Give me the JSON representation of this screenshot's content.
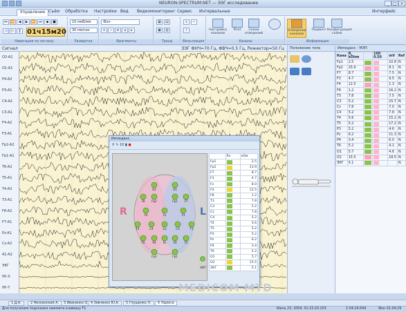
{
  "window": {
    "title": "NEURON-SPECTRUM.NET — ЭЭГ исследование"
  },
  "tabs": [
    "Управление",
    "Съём",
    "Обработка",
    "Настройки",
    "Вид",
    "Видеомониторинг",
    "Сервис",
    "Интервальные"
  ],
  "tab_right": "Интерфейс",
  "ribbon": {
    "time": "01ч15м20",
    "speed": "10 мкВ/мм",
    "sens": "30 мм/сек",
    "montage": "Фон",
    "groups": [
      "Навигация по сигналу",
      "Развертка",
      "Фрагменты",
      "Тренд",
      "Фильтрация",
      "Каналы",
      "Информация"
    ],
    "buttons": {
      "setup_channels": "Настройка каналов",
      "print": "Print",
      "scheme": "Схема отведений",
      "impedance": "Отведение каналов",
      "patient": "Пациент",
      "config": "Конфигурация съёма"
    }
  },
  "subbar": {
    "left": "Сигнал",
    "right": "ЭЭГ ФНЧ=70 Гц, ФВЧ=0.5 Гц, Режектор=50 Гц"
  },
  "channels": [
    "O2-A2",
    "O1-A1",
    "P4-A2",
    "P3-A1",
    "C4-A2",
    "C3-A1",
    "F4-A2",
    "F3-A1",
    "Fp2-A2",
    "Fp1-A1",
    "T6-A2",
    "T5-A1",
    "T4-A2",
    "T3-A1",
    "F8-A2",
    "F7-A1",
    "Pz-A1",
    "Cz-A2",
    "A1-A2",
    "ЭКГ",
    "УК-X",
    "УК-Y"
  ],
  "middle_panel": {
    "header": "Положение тела"
  },
  "impedance_panel": {
    "header": "Импеданс - МЭП",
    "columns": [
      "Кана",
      "R, kOhm",
      "",
      "100 0.50",
      "mV",
      "Ref"
    ],
    "rows": [
      [
        "Fp1",
        "2.5",
        "10.8",
        "N"
      ],
      [
        "Fp2",
        "25.9",
        "8.1",
        "N"
      ],
      [
        "F7",
        "8.7",
        "7.5",
        "N"
      ],
      [
        "F3",
        "4.7",
        "9.5",
        "N"
      ],
      [
        "F4",
        "12.5",
        "1.3",
        "N"
      ],
      [
        "F8",
        "1.2",
        "16.2",
        "N"
      ],
      [
        "T3",
        "7.8",
        "7.5",
        "N"
      ],
      [
        "C3",
        "5.2",
        "15.7",
        "N"
      ],
      [
        "Cz",
        "7.8",
        "7.0",
        "N"
      ],
      [
        "C4",
        "5.2",
        "7.8",
        "N"
      ],
      [
        "T4",
        "5.6",
        "15.2",
        "N"
      ],
      [
        "T5",
        "5.2",
        "17.2",
        "N"
      ],
      [
        "P3",
        "5.2",
        "4.6",
        "N"
      ],
      [
        "Pz",
        "6.2",
        "11.3",
        "N"
      ],
      [
        "P4",
        "3.4",
        "6.0",
        "N"
      ],
      [
        "T6",
        "5.2",
        "4.1",
        "N"
      ],
      [
        "O1",
        "5.7",
        "4.6",
        "N"
      ],
      [
        "O2",
        "15.5",
        "18.5",
        "N"
      ],
      [
        "ЭКГ",
        "5.1",
        "",
        "N"
      ]
    ]
  },
  "dialog": {
    "title": "Импеданс",
    "toolbar_value": "10",
    "left_label": "R",
    "right_label": "L",
    "ecg_label": "ЭКГ",
    "table_header": [
      "",
      "Rх",
      "кОм"
    ],
    "rows": [
      [
        "Fp1",
        "2.5"
      ],
      [
        "Fp2",
        "23.9"
      ],
      [
        "F7",
        "8.7"
      ],
      [
        "F3",
        "4.7"
      ],
      [
        "Fz",
        "8.0"
      ],
      [
        "F4",
        "12.5"
      ],
      [
        "F8",
        "1.2"
      ],
      [
        "T3",
        "7.8"
      ],
      [
        "C3",
        "5.2"
      ],
      [
        "Cz",
        "7.8"
      ],
      [
        "C4",
        "5.2"
      ],
      [
        "T4",
        "5.6"
      ],
      [
        "T5",
        "5.2"
      ],
      [
        "P3",
        "5.2"
      ],
      [
        "Pz",
        "6.2"
      ],
      [
        "P4",
        "3.4"
      ],
      [
        "T6",
        "5.2"
      ],
      [
        "O1",
        "5.7"
      ],
      [
        "O2",
        "15.5"
      ],
      [
        "ЭКГ",
        "5.1"
      ]
    ]
  },
  "electrodes": [
    "O2",
    "O1",
    "F8",
    "Fp2",
    "Fp1",
    "F7",
    "F4",
    "Fz",
    "F3",
    "T4",
    "C4",
    "Cz",
    "C3",
    "T3",
    "T6",
    "P4",
    "Pz",
    "P3",
    "T5",
    "Fp1",
    "Fp2"
  ],
  "watermark": "MEDICOM MTD",
  "footer_tabs": [
    "1 Д.А.",
    "2 Незнанский А.",
    "3 Иваненко О.",
    "4 Зявченко Ю.А.",
    "5 Глущенко Л.",
    "6 Ларюса"
  ],
  "status": {
    "hint": "Для получения подсказки нажмите клавишу F1",
    "date": "Июль 23, 2004, 01:15:20.203",
    "duration": "1:04:29.644",
    "bg": "Фон 01:04:29"
  },
  "colors": {
    "chart_bg": "#f9f3d2",
    "accent": "#f7cf6a",
    "low_imp": "#8bc34a",
    "high_imp": "#ff9fc0"
  }
}
